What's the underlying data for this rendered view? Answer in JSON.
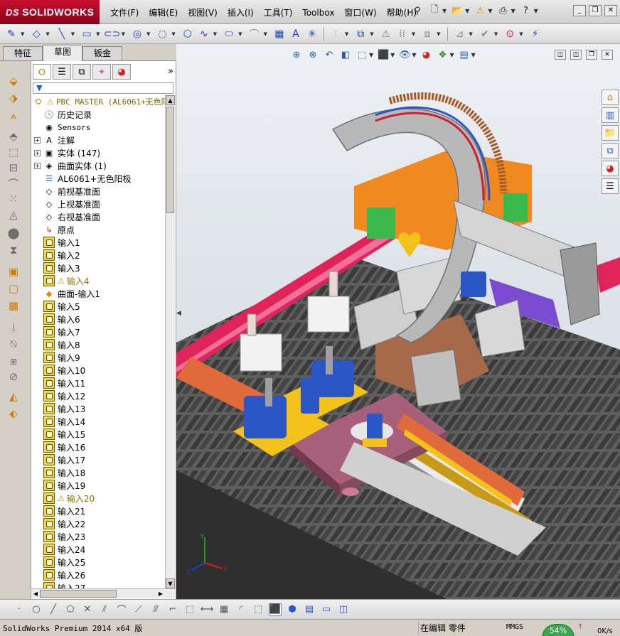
{
  "app": {
    "logo_text": "SOLIDWORKS",
    "logo_prefix": "DS"
  },
  "menubar": {
    "items": [
      "文件(F)",
      "编辑(E)",
      "视图(V)",
      "插入(I)",
      "工具(T)",
      "Toolbox",
      "窗口(W)",
      "帮助(H)"
    ]
  },
  "tabs": [
    "特征",
    "草图",
    "钣金"
  ],
  "active_tab": "草图",
  "tree": {
    "root_label": "PBC MASTER  (AL6061+无色阳",
    "items": [
      {
        "label": "历史记录",
        "icon": "history-icon",
        "expandable": false
      },
      {
        "label": "Sensors",
        "icon": "sensors-icon",
        "expandable": false,
        "mono": true
      },
      {
        "label": "注解",
        "icon": "annotations-icon",
        "expandable": true
      },
      {
        "label": "实体 (147)",
        "icon": "solid-bodies-icon",
        "expandable": true
      },
      {
        "label": "曲面实体 (1)",
        "icon": "surface-bodies-icon",
        "expandable": true
      },
      {
        "label": "AL6061+无色阳极",
        "icon": "material-icon",
        "expandable": false
      },
      {
        "label": "前视基准面",
        "icon": "plane-icon",
        "expandable": false
      },
      {
        "label": "上视基准面",
        "icon": "plane-icon",
        "expandable": false
      },
      {
        "label": "右视基准面",
        "icon": "plane-icon",
        "expandable": false
      },
      {
        "label": "原点",
        "icon": "origin-icon",
        "expandable": false
      },
      {
        "label": "输入1",
        "icon": "imported-body-icon"
      },
      {
        "label": "输入2",
        "icon": "imported-body-icon"
      },
      {
        "label": "输入3",
        "icon": "imported-body-icon"
      },
      {
        "label": "输入4",
        "icon": "imported-body-icon",
        "warning": true
      },
      {
        "label": "曲面-输入1",
        "icon": "surface-import-icon"
      },
      {
        "label": "输入5",
        "icon": "imported-body-icon"
      },
      {
        "label": "输入6",
        "icon": "imported-body-icon"
      },
      {
        "label": "输入7",
        "icon": "imported-body-icon"
      },
      {
        "label": "输入8",
        "icon": "imported-body-icon"
      },
      {
        "label": "输入9",
        "icon": "imported-body-icon"
      },
      {
        "label": "输入10",
        "icon": "imported-body-icon"
      },
      {
        "label": "输入11",
        "icon": "imported-body-icon"
      },
      {
        "label": "输入12",
        "icon": "imported-body-icon"
      },
      {
        "label": "输入13",
        "icon": "imported-body-icon"
      },
      {
        "label": "输入14",
        "icon": "imported-body-icon"
      },
      {
        "label": "输入15",
        "icon": "imported-body-icon"
      },
      {
        "label": "输入16",
        "icon": "imported-body-icon"
      },
      {
        "label": "输入17",
        "icon": "imported-body-icon"
      },
      {
        "label": "输入18",
        "icon": "imported-body-icon"
      },
      {
        "label": "输入19",
        "icon": "imported-body-icon"
      },
      {
        "label": "输入20",
        "icon": "imported-body-icon",
        "warning": true
      },
      {
        "label": "输入21",
        "icon": "imported-body-icon"
      },
      {
        "label": "输入22",
        "icon": "imported-body-icon"
      },
      {
        "label": "输入23",
        "icon": "imported-body-icon"
      },
      {
        "label": "输入24",
        "icon": "imported-body-icon"
      },
      {
        "label": "输入25",
        "icon": "imported-body-icon"
      },
      {
        "label": "输入26",
        "icon": "imported-body-icon"
      },
      {
        "label": "输入27",
        "icon": "imported-body-icon"
      }
    ]
  },
  "triad": {
    "y": "Y",
    "x": "X",
    "z": "Z"
  },
  "statusbar": {
    "product": "SolidWorks Premium 2014 x64 版",
    "mode": "在编辑 零件",
    "units": "MMGS",
    "gauge": "54%",
    "net_speed": "0K/s"
  },
  "colors": {
    "brand_red": "#c8102e",
    "rail_orange": "#e06a3a",
    "body_yellow": "#f2c21a",
    "motor_blue": "#2a56c6",
    "pipe_red": "#e0245a",
    "purple_plate": "#a8607a"
  }
}
